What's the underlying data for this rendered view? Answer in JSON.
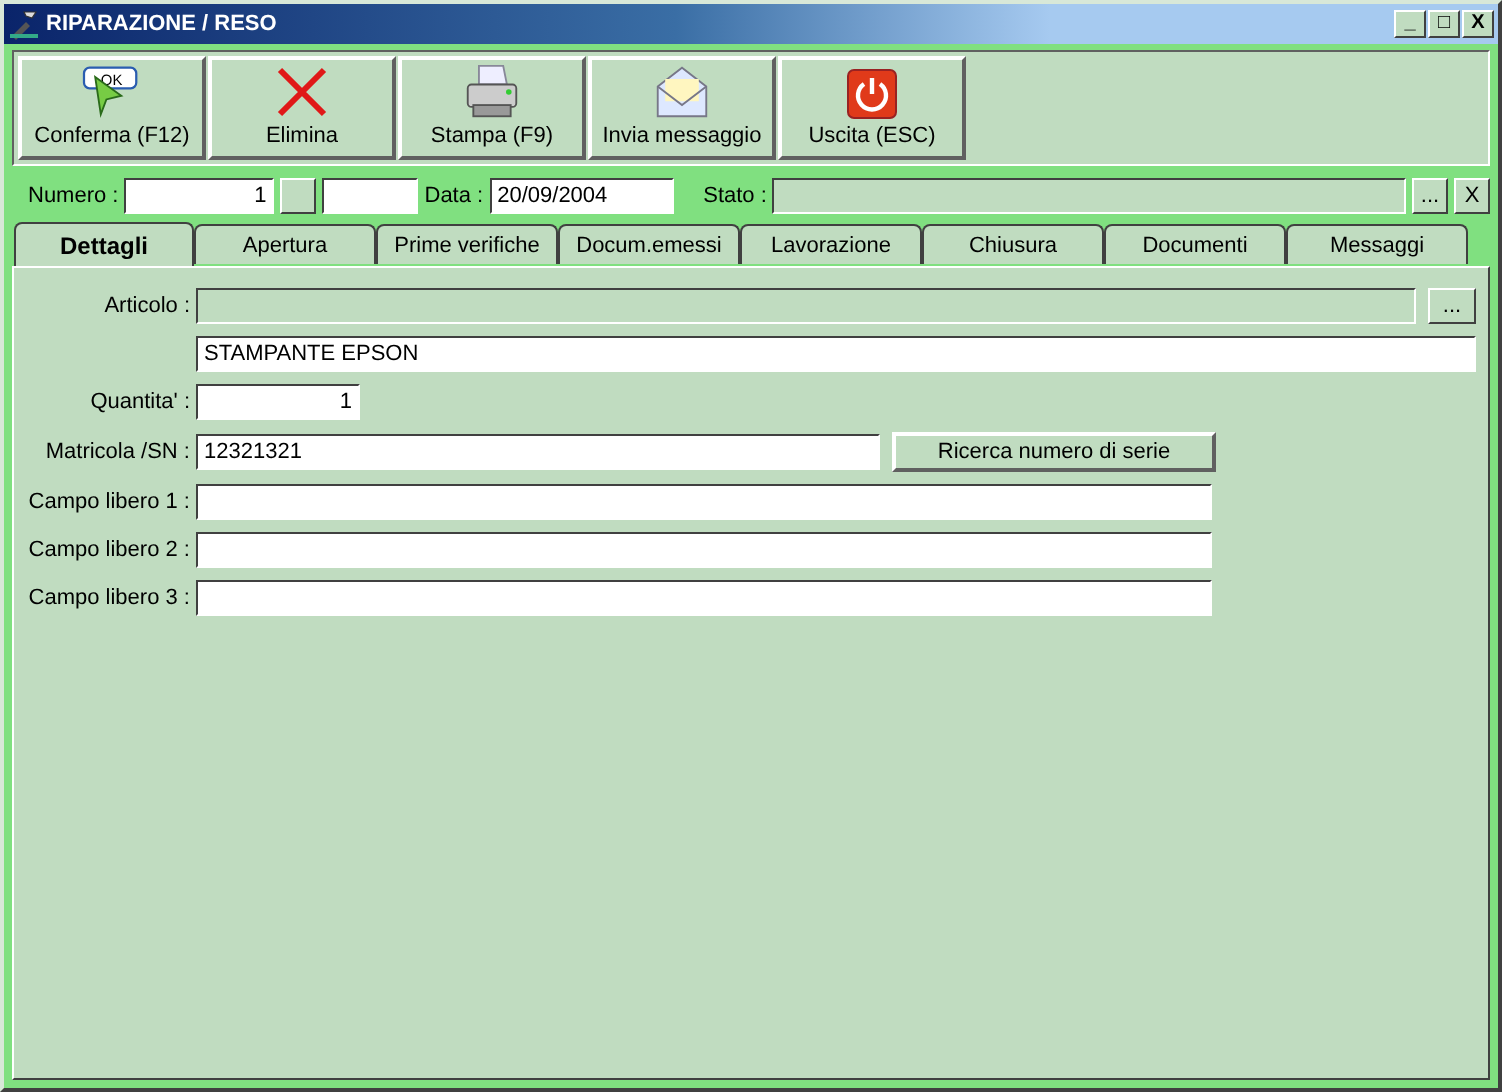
{
  "window": {
    "title": "RIPARAZIONE / RESO",
    "controls": [
      "_",
      "□",
      "X"
    ]
  },
  "toolbar": [
    {
      "kind": "ok",
      "label": "Conferma (F12)",
      "icon_text": "OK"
    },
    {
      "kind": "delete",
      "label": "Elimina"
    },
    {
      "kind": "print",
      "label": "Stampa (F9)"
    },
    {
      "kind": "mail",
      "label": "Invia messaggio"
    },
    {
      "kind": "exit",
      "label": "Uscita (ESC)"
    }
  ],
  "header": {
    "numero_label": "Numero :",
    "numero": "1",
    "data_label": "Data :",
    "data": "20/09/2004",
    "stato_label": "Stato :",
    "browse": "...",
    "clear": "X"
  },
  "tabs": [
    {
      "label": "Dettagli",
      "selected": true
    },
    {
      "label": "Apertura",
      "selected": false
    },
    {
      "label": "Prime verifiche",
      "selected": false
    },
    {
      "label": "Docum.emessi",
      "selected": false
    },
    {
      "label": "Lavorazione",
      "selected": false
    },
    {
      "label": "Chiusura",
      "selected": false
    },
    {
      "label": "Documenti",
      "selected": false
    },
    {
      "label": "Messaggi",
      "selected": false
    }
  ],
  "form": {
    "articolo_label": "Articolo :",
    "articolo_disabled": true,
    "articolo_browse": "...",
    "descrizione": "STAMPANTE EPSON",
    "quantita_label": "Quantita' :",
    "quantita": "1",
    "matricola_label": "Matricola /SN :",
    "matricola": "12321321",
    "ricerca": "Ricerca numero di serie",
    "campi": [
      {
        "label": "Campo libero 1 :"
      },
      {
        "label": "Campo libero 2 :"
      },
      {
        "label": "Campo libero 3 :"
      }
    ]
  }
}
